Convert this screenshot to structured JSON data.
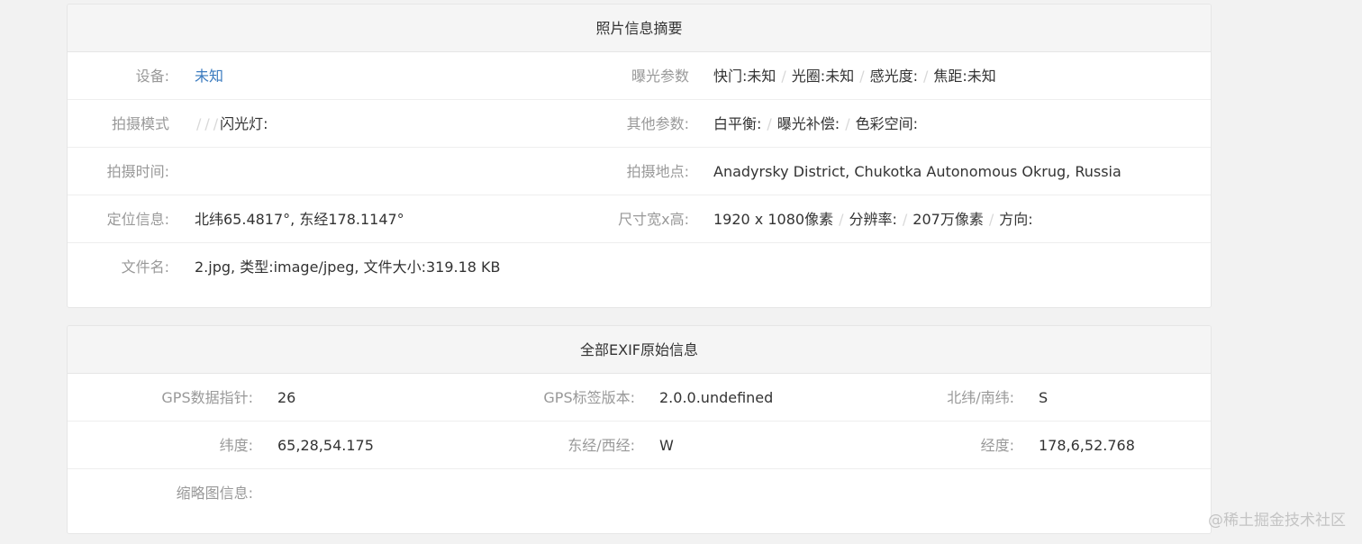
{
  "summary": {
    "title": "照片信息摘要",
    "device_label": "设备:",
    "device_value": "未知",
    "exposure_label": "曝光参数",
    "shutter": "快门:未知",
    "aperture": "光圈:未知",
    "iso": "感光度:",
    "focal": "焦距:未知",
    "mode_label": "拍摄模式",
    "mode_flash": "闪光灯:",
    "other_label": "其他参数:",
    "white_balance": "白平衡:",
    "exposure_comp": "曝光补偿:",
    "color_space": "色彩空间:",
    "time_label": "拍摄时间:",
    "time_value": "",
    "place_label": "拍摄地点:",
    "place_value": "Anadyrsky District, Chukotka Autonomous Okrug, Russia",
    "location_label": "定位信息:",
    "location_value": "北纬65.4817°, 东经178.1147°",
    "size_label": "尺寸宽x高:",
    "size_dims": "1920 x 1080像素",
    "resolution_label": "分辨率:",
    "pixels": "207万像素",
    "orientation": "方向:",
    "file_label": "文件名:",
    "file_value": "2.jpg, 类型:image/jpeg, 文件大小:319.18 KB"
  },
  "exif": {
    "title": "全部EXIF原始信息",
    "rows": [
      [
        {
          "label": "GPS数据指针:",
          "value": "26"
        },
        {
          "label": "GPS标签版本:",
          "value": "2.0.0.undefined"
        },
        {
          "label": "北纬/南纬:",
          "value": "S"
        }
      ],
      [
        {
          "label": "纬度:",
          "value": "65,28,54.175"
        },
        {
          "label": "东经/西经:",
          "value": "W"
        },
        {
          "label": "经度:",
          "value": "178,6,52.768"
        }
      ]
    ],
    "thumb_label": "缩略图信息:",
    "thumb_value": ""
  },
  "watermark": "@稀土掘金技术社区",
  "colors": {
    "background": "#f2f2f2",
    "panel": "#ffffff",
    "header": "#f5f5f5",
    "label": "#999999",
    "link": "#3b7bbf"
  }
}
